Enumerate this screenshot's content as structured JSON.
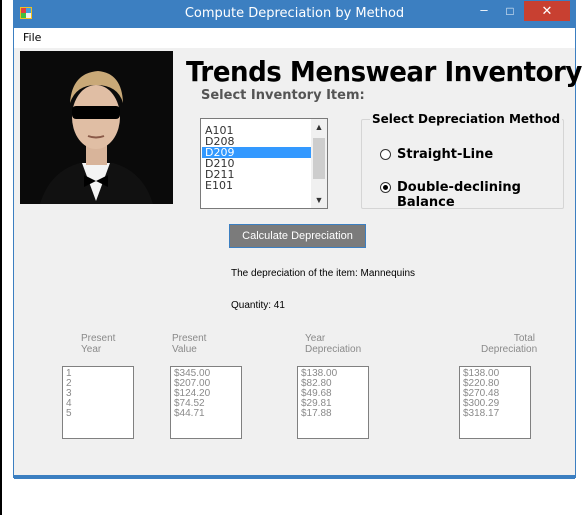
{
  "window": {
    "title": "Compute Depreciation by Method"
  },
  "controls": {
    "minimize": "–",
    "maximize": "□",
    "close": "✕"
  },
  "menu": {
    "file": "File"
  },
  "banner": "Trends Menswear Inventory",
  "inventory": {
    "label": "Select Inventory Item:",
    "items": [
      "A101",
      "D208",
      "D209",
      "D210",
      "D211",
      "E101"
    ],
    "selected": "D209"
  },
  "method": {
    "title": "Select Depreciation Method",
    "option1": "Straight-Line",
    "option2": "Double-declining Balance",
    "selected": "Double-declining Balance"
  },
  "calc_button": "Calculate Depreciation",
  "description_line": "The depreciation of the item: Mannequins",
  "quantity_line": "Quantity: 41",
  "columns": {
    "year": {
      "h1": "Present",
      "h2": "Year",
      "rows": [
        "1",
        "2",
        "3",
        "4",
        "5"
      ]
    },
    "value": {
      "h1": "Present",
      "h2": "Value",
      "rows": [
        "$345.00",
        "$207.00",
        "$124.20",
        "$74.52",
        "$44.71"
      ]
    },
    "yeardep": {
      "h1": "Year",
      "h2": "Depreciation",
      "rows": [
        "$138.00",
        "$82.80",
        "$49.68",
        "$29.81",
        "$17.88"
      ]
    },
    "totaldep": {
      "h1": "Total",
      "h2": "Depreciation",
      "rows": [
        "$138.00",
        "$220.80",
        "$270.48",
        "$300.29",
        "$318.17"
      ]
    }
  },
  "colors": {
    "titlebar": "#3c7fc1",
    "close": "#c84031",
    "selection": "#3399ff",
    "window_bg": "#f0f0f0"
  }
}
